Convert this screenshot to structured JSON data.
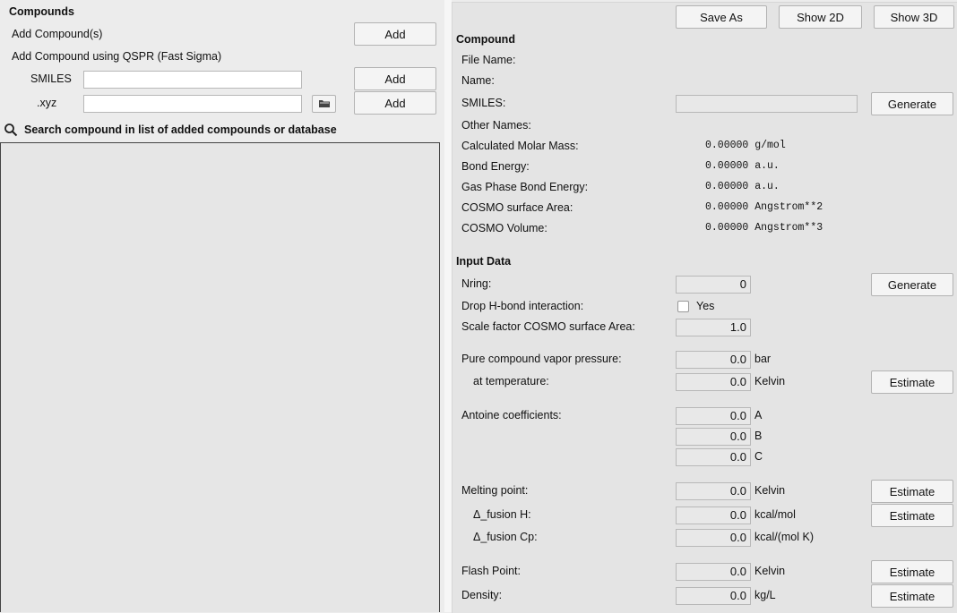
{
  "left": {
    "title": "Compounds",
    "add_compounds_label": "Add Compound(s)",
    "add_button": "Add",
    "qspr_label": "Add Compound using QSPR (Fast Sigma)",
    "smiles_label": "SMILES",
    "smiles_value": "",
    "xyz_label": ".xyz",
    "xyz_value": "",
    "search_label": "Search compound in list of added compounds or database"
  },
  "right": {
    "toolbar": {
      "save_as": "Save As",
      "show_2d": "Show 2D",
      "show_3d": "Show 3D"
    },
    "compound": {
      "heading": "Compound",
      "file_name": "File Name:",
      "name": "Name:",
      "smiles": "SMILES:",
      "smiles_value": "",
      "generate": "Generate",
      "other_names": "Other Names:",
      "rows": [
        {
          "label": "Calculated Molar Mass:",
          "value": "0.00000 g/mol"
        },
        {
          "label": "Bond Energy:",
          "value": "0.00000 a.u."
        },
        {
          "label": "Gas Phase Bond Energy:",
          "value": "0.00000 a.u."
        },
        {
          "label": "COSMO surface Area:",
          "value": "0.00000 Angstrom**2"
        },
        {
          "label": "COSMO Volume:",
          "value": "0.00000 Angstrom**3"
        }
      ]
    },
    "input": {
      "heading": "Input Data",
      "nring_label": "Nring:",
      "nring_value": "0",
      "generate": "Generate",
      "drop_hbond_label": "Drop H-bond interaction:",
      "drop_hbond_option": "Yes",
      "scale_label": "Scale factor COSMO surface Area:",
      "scale_value": "1.0",
      "vp_label": "Pure compound vapor pressure:",
      "vp_value": "0.0",
      "vp_unit": "bar",
      "temp_label": "at temperature:",
      "temp_value": "0.0",
      "temp_unit": "Kelvin",
      "estimate": "Estimate",
      "antoine_label": "Antoine coefficients:",
      "antoine": [
        {
          "value": "0.0",
          "unit": "A"
        },
        {
          "value": "0.0",
          "unit": "B"
        },
        {
          "value": "0.0",
          "unit": "C"
        }
      ],
      "melting_label": "Melting point:",
      "melting_value": "0.0",
      "melting_unit": "Kelvin",
      "fusion_h_label": "Δ_fusion H:",
      "fusion_h_value": "0.0",
      "fusion_h_unit": "kcal/mol",
      "fusion_cp_label": "Δ_fusion Cp:",
      "fusion_cp_value": "0.0",
      "fusion_cp_unit": "kcal/(mol K)",
      "flash_label": "Flash Point:",
      "flash_value": "0.0",
      "flash_unit": "Kelvin",
      "density_label": "Density:",
      "density_value": "0.0",
      "density_unit": "kg/L"
    }
  }
}
